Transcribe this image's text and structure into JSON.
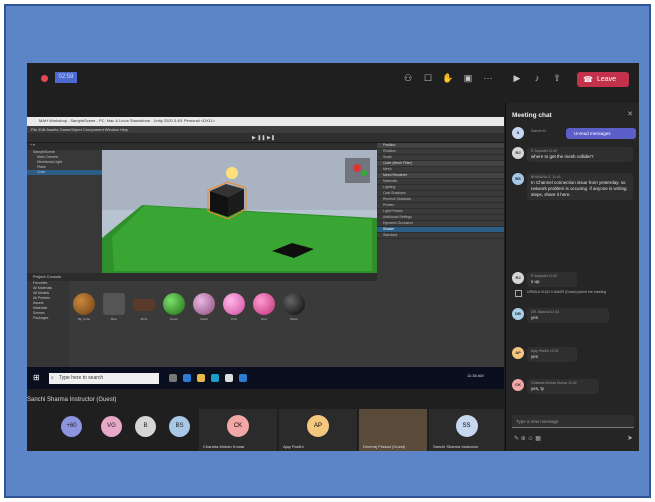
{
  "meeting": {
    "timer": "02:59",
    "leave_label": "Leave",
    "presenter_label": "Sanchi Sharma Instructor (Guest)"
  },
  "unity": {
    "title": "MAH Workshop - SampleScene - PC, Mac & Linux Standalone - Unity 2020.3.4f1 Personal <DX11>",
    "menu": "File  Edit  Assets  GameObject  Component  Window  Help",
    "play": "▶ ❚❚ ▶❚",
    "hierarchy": [
      "SampleScene",
      "Main Camera",
      "Directional Light",
      "Plane",
      "Cube"
    ],
    "inspector_rows": [
      "Position",
      "Rotation",
      "Scale",
      "Cube (Mesh Filter)",
      "Mesh",
      "Mesh Renderer",
      "Materials",
      "Lighting",
      "Cast Shadows",
      "Receive Shadows",
      "Probes",
      "Light Probes",
      "Additional Settings",
      "Dynamic Occlusion",
      "Shader",
      "Standard"
    ],
    "project_tabs": "Project   Console",
    "project_tree": [
      "Favorites",
      "All Materials",
      "All Models",
      "All Prefabs",
      "Assets",
      "Materials",
      "Scenes",
      "Packages"
    ],
    "assets": [
      "Bk_Cube",
      "Blue",
      "Brick",
      "Green",
      "Metal",
      "Pink",
      "Red",
      "Black"
    ],
    "taskbar_search": "Type here to search",
    "taskbar_clock": "11:38 AM"
  },
  "participants": [
    {
      "initials": "+60",
      "color": "#8e95e0"
    },
    {
      "initials": "VG",
      "color": "#e8a8c8"
    },
    {
      "initials": "B",
      "color": "#d6d6d6"
    },
    {
      "initials": "BS",
      "color": "#a8c8e8"
    }
  ],
  "tiles": [
    {
      "initials": "CK",
      "name": "Chandra Mohan Kumar",
      "color": "#f2a7a7"
    },
    {
      "initials": "AP",
      "name": "Ajay Pardhi",
      "color": "#f5c77e"
    },
    {
      "initials": "",
      "name": "Dheeraj Prasad (Guest)",
      "color": "#6b5a4a"
    },
    {
      "initials": "SS",
      "name": "Sanchi Sharma Instructor",
      "color": "#c8d8f0"
    }
  ],
  "chat": {
    "title": "Meeting chat",
    "unread": "Unread messages",
    "messages": [
      {
        "author": "Sanchi M.",
        "time": "",
        "text": "",
        "color": "#c8d8f0",
        "initials": "S"
      },
      {
        "author": "R Jayanthi",
        "time": "11:40",
        "text": "where to get the mesh collider?",
        "color": "#d6d6d6",
        "initials": "RJ"
      },
      {
        "author": "BHAVANA S.",
        "time": "11:41",
        "text": "In Channel connection issue from yesterday. so network problem is occuring. if anyone is writing steps, share it here.",
        "color": "#a8c8e8",
        "initials": "BS"
      },
      {
        "author": "R Jayanthi",
        "time": "11:42",
        "text": "s up",
        "color": "#d6d6d6",
        "initials": "RJ"
      },
      {
        "author": "DR. Babulal",
        "time": "11:43",
        "text": "yes",
        "color": "#a8d0e8",
        "initials": "DB"
      },
      {
        "author": "Ajay Pardhi",
        "time": "11:51",
        "text": "yes",
        "color": "#f5c77e",
        "initials": "AP"
      },
      {
        "author": "Chandra Mohan Kumar",
        "time": "11:52",
        "text": "yes, ty",
        "color": "#f2a7a7",
        "initials": "CK"
      }
    ],
    "system_note": "URMILA VIJAY KUMAR (Guest) joined the meeting",
    "compose_placeholder": "Type a new message"
  }
}
